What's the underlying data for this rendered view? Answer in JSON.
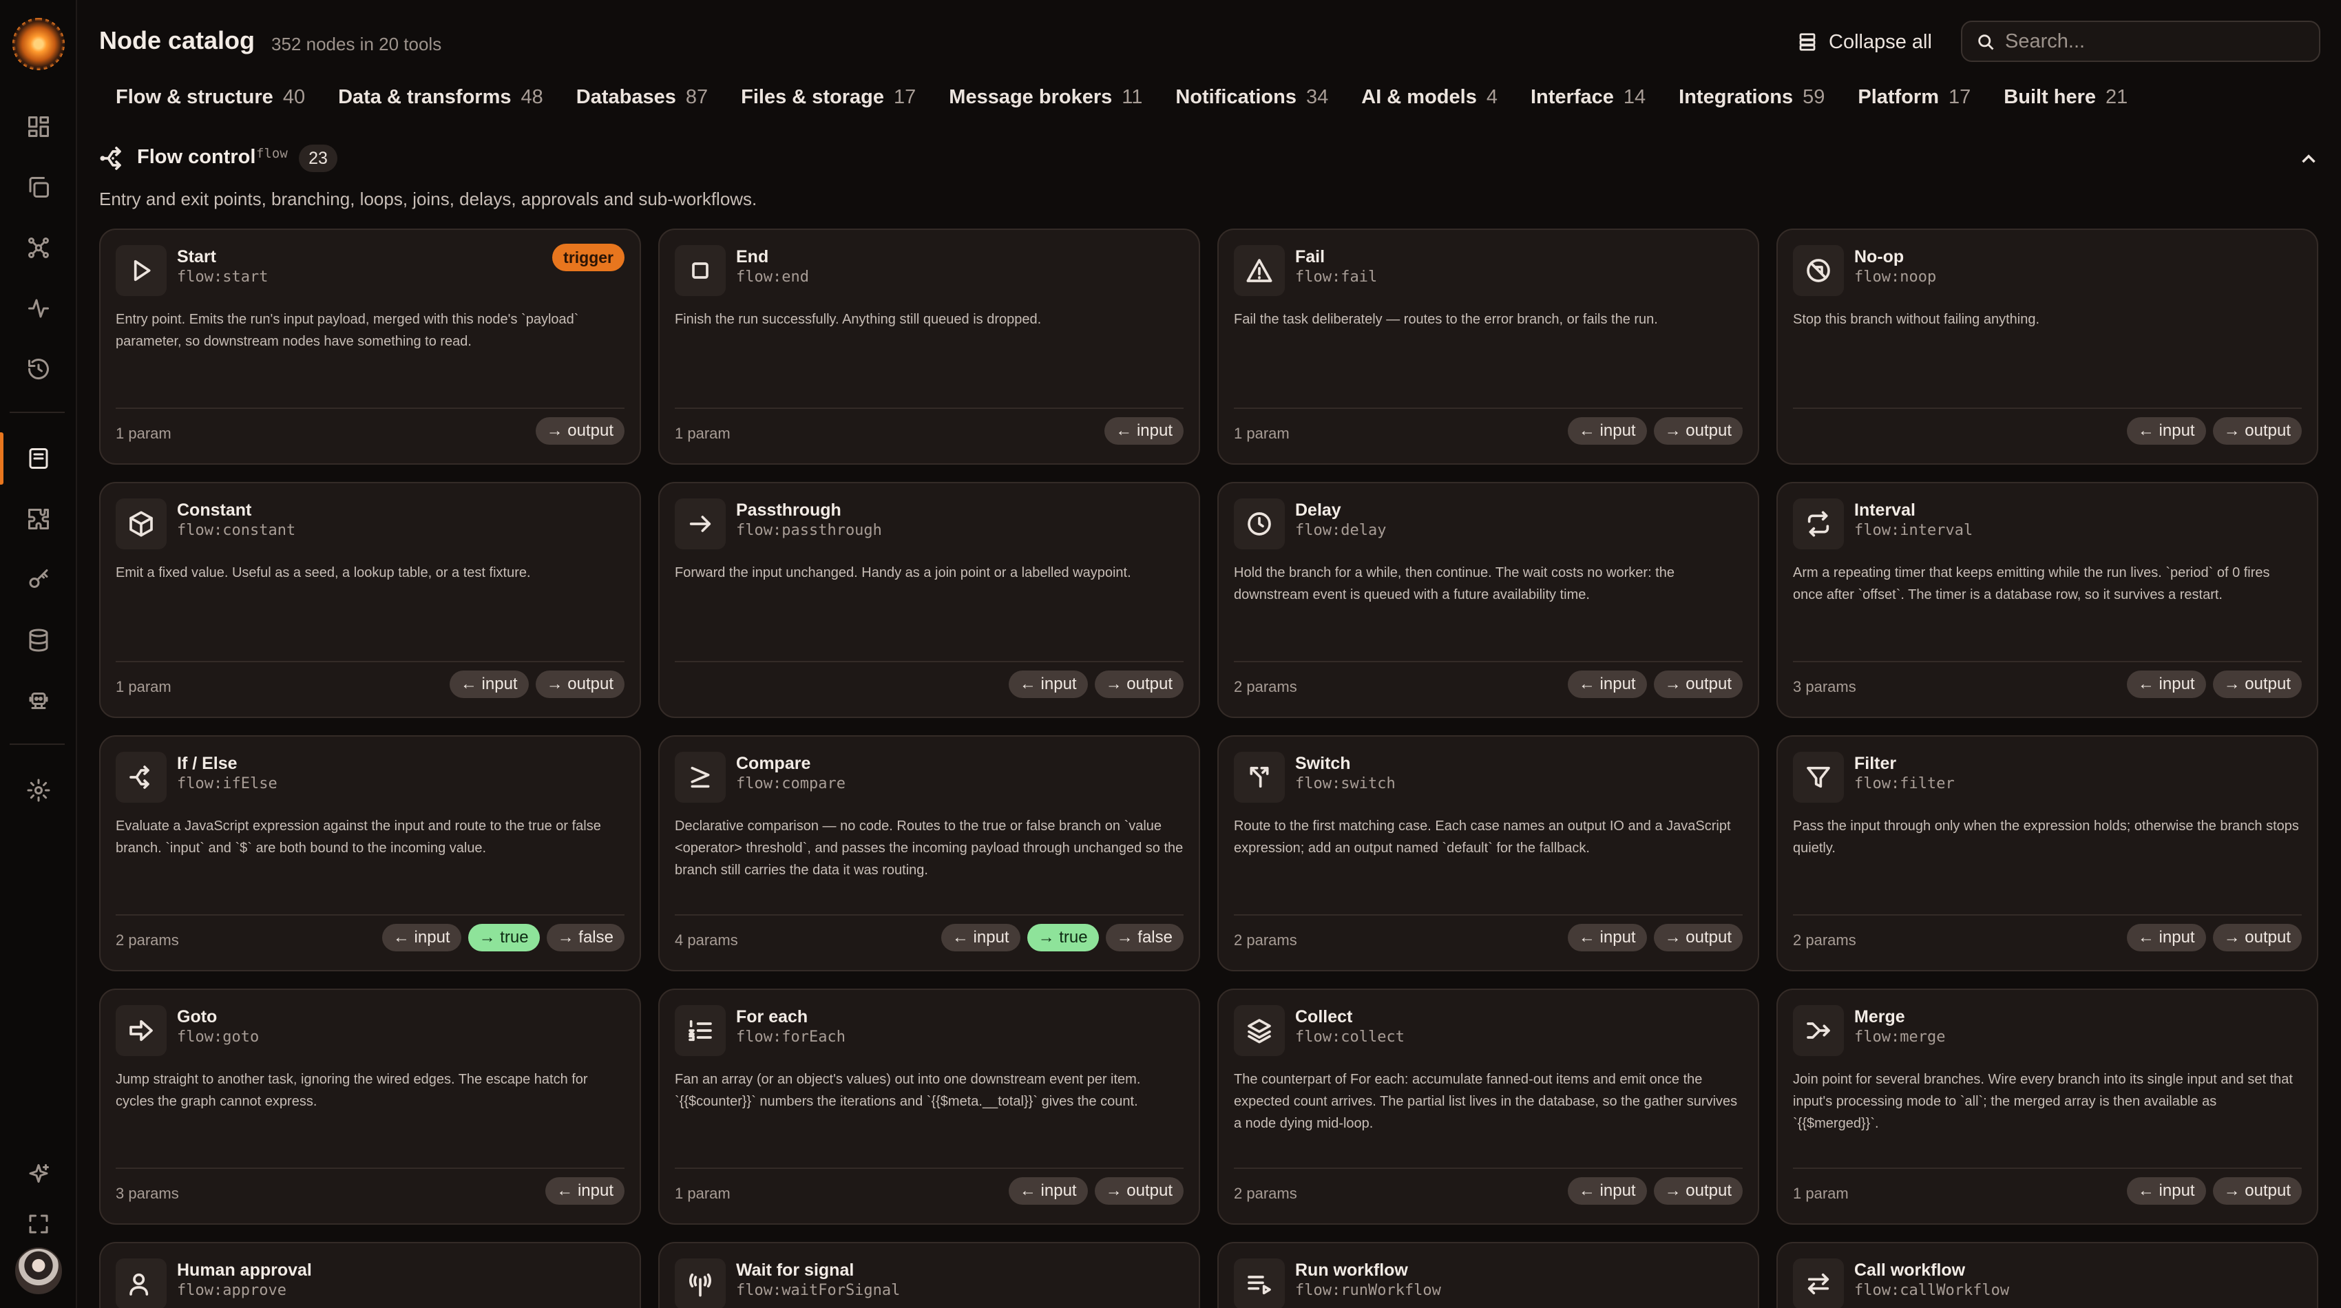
{
  "header": {
    "title": "Node catalog",
    "subtitle": "352 nodes in 20 tools",
    "collapse_label": "Collapse all",
    "search_placeholder": "Search..."
  },
  "tabs": [
    {
      "label": "Flow & structure",
      "count": "40"
    },
    {
      "label": "Data & transforms",
      "count": "48"
    },
    {
      "label": "Databases",
      "count": "87"
    },
    {
      "label": "Files & storage",
      "count": "17"
    },
    {
      "label": "Message brokers",
      "count": "11"
    },
    {
      "label": "Notifications",
      "count": "34"
    },
    {
      "label": "AI & models",
      "count": "4"
    },
    {
      "label": "Interface",
      "count": "14"
    },
    {
      "label": "Integrations",
      "count": "59"
    },
    {
      "label": "Platform",
      "count": "17"
    },
    {
      "label": "Built here",
      "count": "21"
    }
  ],
  "section": {
    "title": "Flow control",
    "key": "flow",
    "count": "23",
    "description": "Entry and exit points, branching, loops, joins, delays, approvals and sub-workflows."
  },
  "cards": [
    {
      "name": "Start",
      "key": "flow:start",
      "icon": "play-icon",
      "badge": "trigger",
      "desc": "Entry point. Emits the run's input payload, merged with this node's `payload` parameter, so downstream nodes have something to read.",
      "params": "1 param",
      "ports": [
        {
          "label": "→ output",
          "kind": "out"
        }
      ]
    },
    {
      "name": "End",
      "key": "flow:end",
      "icon": "stop-square-icon",
      "desc": "Finish the run successfully. Anything still queued is dropped.",
      "params": "1 param",
      "ports": [
        {
          "label": "← input",
          "kind": "in"
        }
      ]
    },
    {
      "name": "Fail",
      "key": "flow:fail",
      "icon": "warning-triangle-icon",
      "desc": "Fail the task deliberately — routes to the error branch, or fails the run.",
      "params": "1 param",
      "ports": [
        {
          "label": "← input",
          "kind": "in"
        },
        {
          "label": "→ output",
          "kind": "out"
        }
      ]
    },
    {
      "name": "No-op",
      "key": "flow:noop",
      "icon": "circle-slash-icon",
      "desc": "Stop this branch without failing anything.",
      "params": "",
      "ports": [
        {
          "label": "← input",
          "kind": "in"
        },
        {
          "label": "→ output",
          "kind": "out"
        }
      ]
    },
    {
      "name": "Constant",
      "key": "flow:constant",
      "icon": "cube-icon",
      "desc": "Emit a fixed value. Useful as a seed, a lookup table, or a test fixture.",
      "params": "1 param",
      "ports": [
        {
          "label": "← input",
          "kind": "in"
        },
        {
          "label": "→ output",
          "kind": "out"
        }
      ]
    },
    {
      "name": "Passthrough",
      "key": "flow:passthrough",
      "icon": "arrow-right-icon",
      "desc": "Forward the input unchanged. Handy as a join point or a labelled waypoint.",
      "params": "",
      "ports": [
        {
          "label": "← input",
          "kind": "in"
        },
        {
          "label": "→ output",
          "kind": "out"
        }
      ]
    },
    {
      "name": "Delay",
      "key": "flow:delay",
      "icon": "clock-icon",
      "desc": "Hold the branch for a while, then continue. The wait costs no worker: the downstream event is queued with a future availability time.",
      "params": "2 params",
      "ports": [
        {
          "label": "← input",
          "kind": "in"
        },
        {
          "label": "→ output",
          "kind": "out"
        }
      ]
    },
    {
      "name": "Interval",
      "key": "flow:interval",
      "icon": "repeat-icon",
      "desc": "Arm a repeating timer that keeps emitting while the run lives. `period` of 0 fires once after `offset`. The timer is a database row, so it survives a restart.",
      "params": "3 params",
      "ports": [
        {
          "label": "← input",
          "kind": "in"
        },
        {
          "label": "→ output",
          "kind": "out"
        }
      ]
    },
    {
      "name": "If / Else",
      "key": "flow:ifElse",
      "icon": "split-icon",
      "desc": "Evaluate a JavaScript expression against the input and route to the true or false branch. `input` and `$` are both bound to the incoming value.",
      "params": "2 params",
      "ports": [
        {
          "label": "← input",
          "kind": "in"
        },
        {
          "label": "→ true",
          "kind": "true"
        },
        {
          "label": "→ false",
          "kind": "out"
        }
      ]
    },
    {
      "name": "Compare",
      "key": "flow:compare",
      "icon": "greater-equal-icon",
      "desc": "Declarative comparison — no code. Routes to the true or false branch on `value <operator> threshold`, and passes the incoming payload through unchanged so the branch still carries the data it was routing.",
      "params": "4 params",
      "ports": [
        {
          "label": "← input",
          "kind": "in"
        },
        {
          "label": "→ true",
          "kind": "true"
        },
        {
          "label": "→ false",
          "kind": "out"
        }
      ]
    },
    {
      "name": "Switch",
      "key": "flow:switch",
      "icon": "fork-arrows-icon",
      "desc": "Route to the first matching case. Each case names an output IO and a JavaScript expression; add an output named `default` for the fallback.",
      "params": "2 params",
      "ports": [
        {
          "label": "← input",
          "kind": "in"
        },
        {
          "label": "→ output",
          "kind": "out"
        }
      ]
    },
    {
      "name": "Filter",
      "key": "flow:filter",
      "icon": "funnel-icon",
      "desc": "Pass the input through only when the expression holds; otherwise the branch stops quietly.",
      "params": "2 params",
      "ports": [
        {
          "label": "← input",
          "kind": "in"
        },
        {
          "label": "→ output",
          "kind": "out"
        }
      ]
    },
    {
      "name": "Goto",
      "key": "flow:goto",
      "icon": "arrow-fat-right-icon",
      "desc": "Jump straight to another task, ignoring the wired edges. The escape hatch for cycles the graph cannot express.",
      "params": "3 params",
      "ports": [
        {
          "label": "← input",
          "kind": "in"
        }
      ]
    },
    {
      "name": "For each",
      "key": "flow:forEach",
      "icon": "numbered-list-icon",
      "desc": "Fan an array (or an object's values) out into one downstream event per item. `{{$counter}}` numbers the iterations and `{{$meta.__total}}` gives the count.",
      "params": "1 param",
      "ports": [
        {
          "label": "← input",
          "kind": "in"
        },
        {
          "label": "→ output",
          "kind": "out"
        }
      ]
    },
    {
      "name": "Collect",
      "key": "flow:collect",
      "icon": "layers-icon",
      "desc": "The counterpart of For each: accumulate fanned-out items and emit once the expected count arrives. The partial list lives in the database, so the gather survives a node dying mid-loop.",
      "params": "2 params",
      "ports": [
        {
          "label": "← input",
          "kind": "in"
        },
        {
          "label": "→ output",
          "kind": "out"
        }
      ]
    },
    {
      "name": "Merge",
      "key": "flow:merge",
      "icon": "merge-icon",
      "desc": "Join point for several branches. Wire every branch into its single input and set that input's processing mode to `all`; the merged array is then available as `{{$merged}}`.",
      "params": "1 param",
      "ports": [
        {
          "label": "← input",
          "kind": "in"
        },
        {
          "label": "→ output",
          "kind": "out"
        }
      ]
    },
    {
      "name": "Human approval",
      "key": "flow:approve",
      "icon": "user-check-icon",
      "partial": true
    },
    {
      "name": "Wait for signal",
      "key": "flow:waitForSignal",
      "icon": "signal-tower-icon",
      "partial": true
    },
    {
      "name": "Run workflow",
      "key": "flow:runWorkflow",
      "icon": "list-play-icon",
      "partial": true
    },
    {
      "name": "Call workflow",
      "key": "flow:callWorkflow",
      "icon": "arrows-swap-icon",
      "partial": true
    }
  ]
}
